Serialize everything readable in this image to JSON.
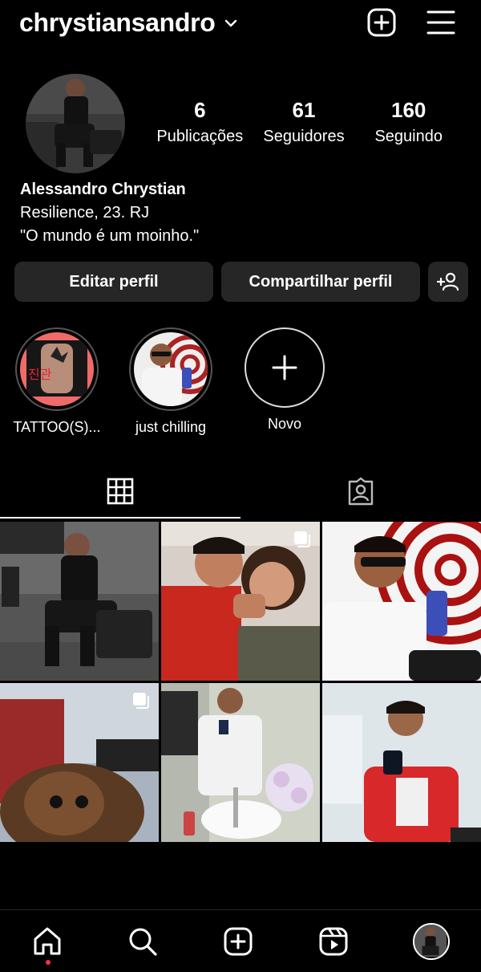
{
  "header": {
    "username": "chrystiansandro",
    "icons": [
      "chevron-down-icon",
      "new-post-icon",
      "menu-icon"
    ]
  },
  "profile": {
    "stats": [
      {
        "value": "6",
        "label": "Publicações"
      },
      {
        "value": "61",
        "label": "Seguidores"
      },
      {
        "value": "160",
        "label": "Seguindo"
      }
    ],
    "name": "Alessandro Chrystian",
    "bio_line1": "Resilience, 23. RJ",
    "bio_line2": "\"O mundo é um moinho.\""
  },
  "actions": {
    "edit_label": "Editar perfil",
    "share_label": "Compartilhar perfil",
    "discover_icon": "add-person-icon"
  },
  "highlights": [
    {
      "label": "TATTOO(S)..."
    },
    {
      "label": "just chilling"
    },
    {
      "label": "Novo"
    }
  ],
  "tabs": [
    "grid-icon",
    "tagged-icon"
  ],
  "posts": [
    {
      "multi": false
    },
    {
      "multi": true
    },
    {
      "multi": false
    },
    {
      "multi": true
    },
    {
      "multi": false
    },
    {
      "multi": false
    }
  ],
  "nav": [
    "home-icon",
    "search-icon",
    "create-icon",
    "reels-icon",
    "profile-avatar"
  ],
  "colors": {
    "background": "#000000",
    "button": "#262626",
    "notification_dot": "#ff3040"
  }
}
